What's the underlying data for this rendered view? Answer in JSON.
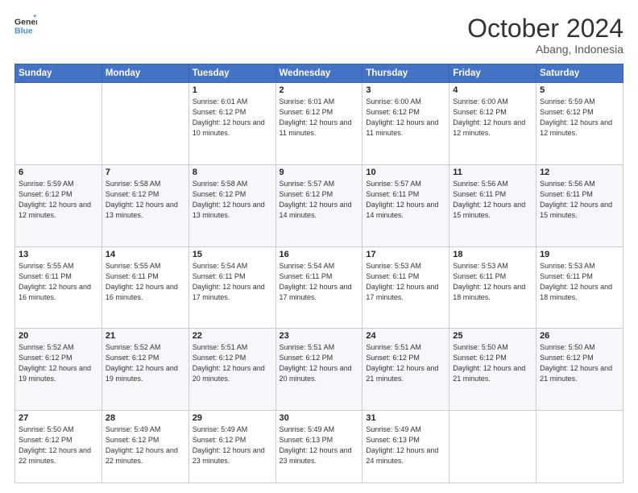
{
  "header": {
    "logo_line1": "General",
    "logo_line2": "Blue",
    "month": "October 2024",
    "location": "Abang, Indonesia"
  },
  "weekdays": [
    "Sunday",
    "Monday",
    "Tuesday",
    "Wednesday",
    "Thursday",
    "Friday",
    "Saturday"
  ],
  "weeks": [
    [
      {
        "day": "",
        "sunrise": "",
        "sunset": "",
        "daylight": ""
      },
      {
        "day": "",
        "sunrise": "",
        "sunset": "",
        "daylight": ""
      },
      {
        "day": "1",
        "sunrise": "Sunrise: 6:01 AM",
        "sunset": "Sunset: 6:12 PM",
        "daylight": "Daylight: 12 hours and 10 minutes."
      },
      {
        "day": "2",
        "sunrise": "Sunrise: 6:01 AM",
        "sunset": "Sunset: 6:12 PM",
        "daylight": "Daylight: 12 hours and 11 minutes."
      },
      {
        "day": "3",
        "sunrise": "Sunrise: 6:00 AM",
        "sunset": "Sunset: 6:12 PM",
        "daylight": "Daylight: 12 hours and 11 minutes."
      },
      {
        "day": "4",
        "sunrise": "Sunrise: 6:00 AM",
        "sunset": "Sunset: 6:12 PM",
        "daylight": "Daylight: 12 hours and 12 minutes."
      },
      {
        "day": "5",
        "sunrise": "Sunrise: 5:59 AM",
        "sunset": "Sunset: 6:12 PM",
        "daylight": "Daylight: 12 hours and 12 minutes."
      }
    ],
    [
      {
        "day": "6",
        "sunrise": "Sunrise: 5:59 AM",
        "sunset": "Sunset: 6:12 PM",
        "daylight": "Daylight: 12 hours and 12 minutes."
      },
      {
        "day": "7",
        "sunrise": "Sunrise: 5:58 AM",
        "sunset": "Sunset: 6:12 PM",
        "daylight": "Daylight: 12 hours and 13 minutes."
      },
      {
        "day": "8",
        "sunrise": "Sunrise: 5:58 AM",
        "sunset": "Sunset: 6:12 PM",
        "daylight": "Daylight: 12 hours and 13 minutes."
      },
      {
        "day": "9",
        "sunrise": "Sunrise: 5:57 AM",
        "sunset": "Sunset: 6:12 PM",
        "daylight": "Daylight: 12 hours and 14 minutes."
      },
      {
        "day": "10",
        "sunrise": "Sunrise: 5:57 AM",
        "sunset": "Sunset: 6:11 PM",
        "daylight": "Daylight: 12 hours and 14 minutes."
      },
      {
        "day": "11",
        "sunrise": "Sunrise: 5:56 AM",
        "sunset": "Sunset: 6:11 PM",
        "daylight": "Daylight: 12 hours and 15 minutes."
      },
      {
        "day": "12",
        "sunrise": "Sunrise: 5:56 AM",
        "sunset": "Sunset: 6:11 PM",
        "daylight": "Daylight: 12 hours and 15 minutes."
      }
    ],
    [
      {
        "day": "13",
        "sunrise": "Sunrise: 5:55 AM",
        "sunset": "Sunset: 6:11 PM",
        "daylight": "Daylight: 12 hours and 16 minutes."
      },
      {
        "day": "14",
        "sunrise": "Sunrise: 5:55 AM",
        "sunset": "Sunset: 6:11 PM",
        "daylight": "Daylight: 12 hours and 16 minutes."
      },
      {
        "day": "15",
        "sunrise": "Sunrise: 5:54 AM",
        "sunset": "Sunset: 6:11 PM",
        "daylight": "Daylight: 12 hours and 17 minutes."
      },
      {
        "day": "16",
        "sunrise": "Sunrise: 5:54 AM",
        "sunset": "Sunset: 6:11 PM",
        "daylight": "Daylight: 12 hours and 17 minutes."
      },
      {
        "day": "17",
        "sunrise": "Sunrise: 5:53 AM",
        "sunset": "Sunset: 6:11 PM",
        "daylight": "Daylight: 12 hours and 17 minutes."
      },
      {
        "day": "18",
        "sunrise": "Sunrise: 5:53 AM",
        "sunset": "Sunset: 6:11 PM",
        "daylight": "Daylight: 12 hours and 18 minutes."
      },
      {
        "day": "19",
        "sunrise": "Sunrise: 5:53 AM",
        "sunset": "Sunset: 6:11 PM",
        "daylight": "Daylight: 12 hours and 18 minutes."
      }
    ],
    [
      {
        "day": "20",
        "sunrise": "Sunrise: 5:52 AM",
        "sunset": "Sunset: 6:12 PM",
        "daylight": "Daylight: 12 hours and 19 minutes."
      },
      {
        "day": "21",
        "sunrise": "Sunrise: 5:52 AM",
        "sunset": "Sunset: 6:12 PM",
        "daylight": "Daylight: 12 hours and 19 minutes."
      },
      {
        "day": "22",
        "sunrise": "Sunrise: 5:51 AM",
        "sunset": "Sunset: 6:12 PM",
        "daylight": "Daylight: 12 hours and 20 minutes."
      },
      {
        "day": "23",
        "sunrise": "Sunrise: 5:51 AM",
        "sunset": "Sunset: 6:12 PM",
        "daylight": "Daylight: 12 hours and 20 minutes."
      },
      {
        "day": "24",
        "sunrise": "Sunrise: 5:51 AM",
        "sunset": "Sunset: 6:12 PM",
        "daylight": "Daylight: 12 hours and 21 minutes."
      },
      {
        "day": "25",
        "sunrise": "Sunrise: 5:50 AM",
        "sunset": "Sunset: 6:12 PM",
        "daylight": "Daylight: 12 hours and 21 minutes."
      },
      {
        "day": "26",
        "sunrise": "Sunrise: 5:50 AM",
        "sunset": "Sunset: 6:12 PM",
        "daylight": "Daylight: 12 hours and 21 minutes."
      }
    ],
    [
      {
        "day": "27",
        "sunrise": "Sunrise: 5:50 AM",
        "sunset": "Sunset: 6:12 PM",
        "daylight": "Daylight: 12 hours and 22 minutes."
      },
      {
        "day": "28",
        "sunrise": "Sunrise: 5:49 AM",
        "sunset": "Sunset: 6:12 PM",
        "daylight": "Daylight: 12 hours and 22 minutes."
      },
      {
        "day": "29",
        "sunrise": "Sunrise: 5:49 AM",
        "sunset": "Sunset: 6:12 PM",
        "daylight": "Daylight: 12 hours and 23 minutes."
      },
      {
        "day": "30",
        "sunrise": "Sunrise: 5:49 AM",
        "sunset": "Sunset: 6:13 PM",
        "daylight": "Daylight: 12 hours and 23 minutes."
      },
      {
        "day": "31",
        "sunrise": "Sunrise: 5:49 AM",
        "sunset": "Sunset: 6:13 PM",
        "daylight": "Daylight: 12 hours and 24 minutes."
      },
      {
        "day": "",
        "sunrise": "",
        "sunset": "",
        "daylight": ""
      },
      {
        "day": "",
        "sunrise": "",
        "sunset": "",
        "daylight": ""
      }
    ]
  ]
}
